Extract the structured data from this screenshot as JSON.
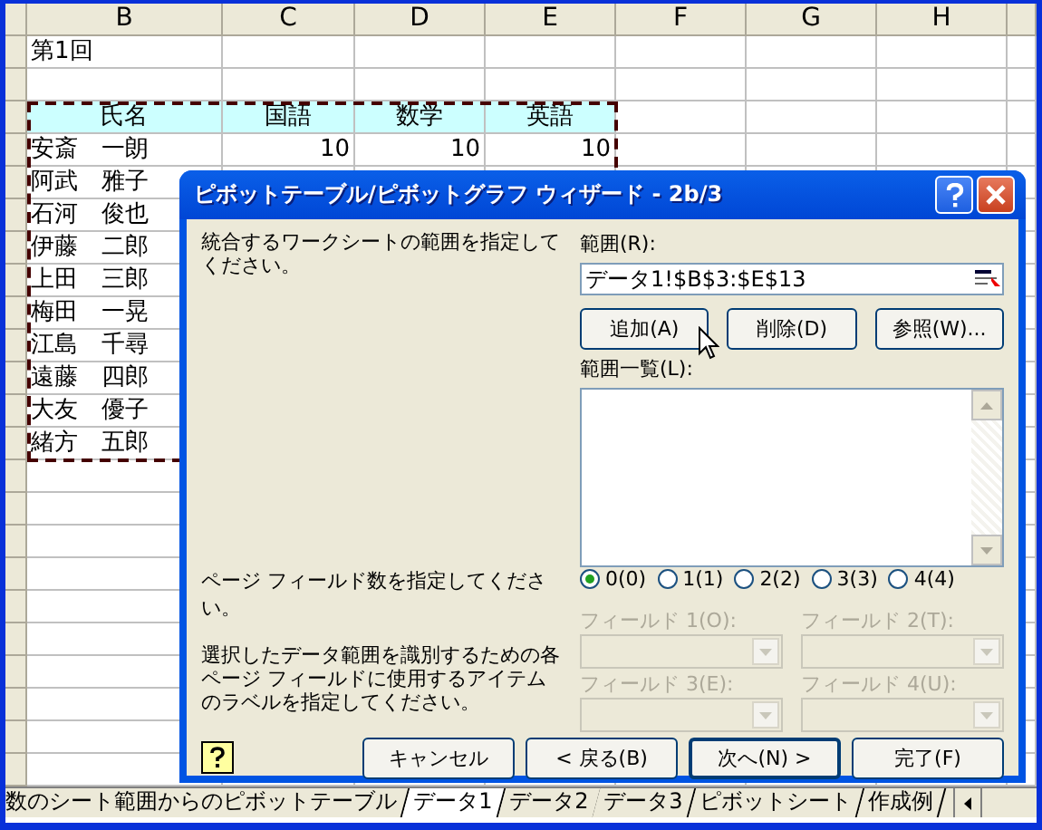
{
  "sheet": {
    "columns": [
      "B",
      "C",
      "D",
      "E",
      "F",
      "G",
      "H"
    ],
    "title_cell": "第1回",
    "table": {
      "header": [
        "氏名",
        "国語",
        "数学",
        "英語"
      ],
      "rows": [
        {
          "name": "安斎　一朗",
          "scores": [
            "10",
            "10",
            "10"
          ]
        },
        {
          "name": "阿武　雅子"
        },
        {
          "name": "石河　俊也"
        },
        {
          "name": "伊藤　二郎"
        },
        {
          "name": "上田　三郎"
        },
        {
          "name": "梅田　一晃"
        },
        {
          "name": "江島　千尋"
        },
        {
          "name": "遠藤　四郎"
        },
        {
          "name": "大友　優子"
        },
        {
          "name": "緒方　五郎"
        }
      ]
    }
  },
  "dialog": {
    "title": "ピボットテーブル/ピボットグラフ ウィザード - 2b/3",
    "range_prompt": "統合するワークシートの範囲を指定してください。",
    "range_label": "範囲(R):",
    "range_value": "データ1!$B$3:$E$13",
    "range_buttons": [
      "追加(A)",
      "削除(D)",
      "参照(W)..."
    ],
    "list_label": "範囲一覧(L):",
    "page_prompt": "ページ フィールド数を指定してください。",
    "page_options": [
      {
        "label": "0(0)",
        "selected": true
      },
      {
        "label": "1(1)",
        "selected": false
      },
      {
        "label": "2(2)",
        "selected": false
      },
      {
        "label": "3(3)",
        "selected": false
      },
      {
        "label": "4(4)",
        "selected": false
      }
    ],
    "item_prompt": "選択したデータ範囲を識別するための各ページ フィールドに使用するアイテムのラベルを指定してください。",
    "fields": [
      {
        "label": "フィールド 1(O):",
        "disabled": true
      },
      {
        "label": "フィールド 2(T):",
        "disabled": true
      },
      {
        "label": "フィールド 3(E):",
        "disabled": true
      },
      {
        "label": "フィールド 4(U):",
        "disabled": true
      }
    ],
    "footer_buttons": [
      {
        "label": "キャンセル",
        "default": false
      },
      {
        "label": "< 戻る(B)",
        "default": false
      },
      {
        "label": "次へ(N) >",
        "default": true
      },
      {
        "label": "完了(F)",
        "default": false
      }
    ]
  },
  "sheet_tabs": [
    {
      "label": "数のシート範囲からのピボットテーブル",
      "selected": false
    },
    {
      "label": "データ1",
      "selected": true
    },
    {
      "label": "データ2",
      "selected": false
    },
    {
      "label": "データ3",
      "selected": false
    },
    {
      "label": "ピボットシート",
      "selected": false
    },
    {
      "label": "作成例",
      "selected": false
    }
  ]
}
